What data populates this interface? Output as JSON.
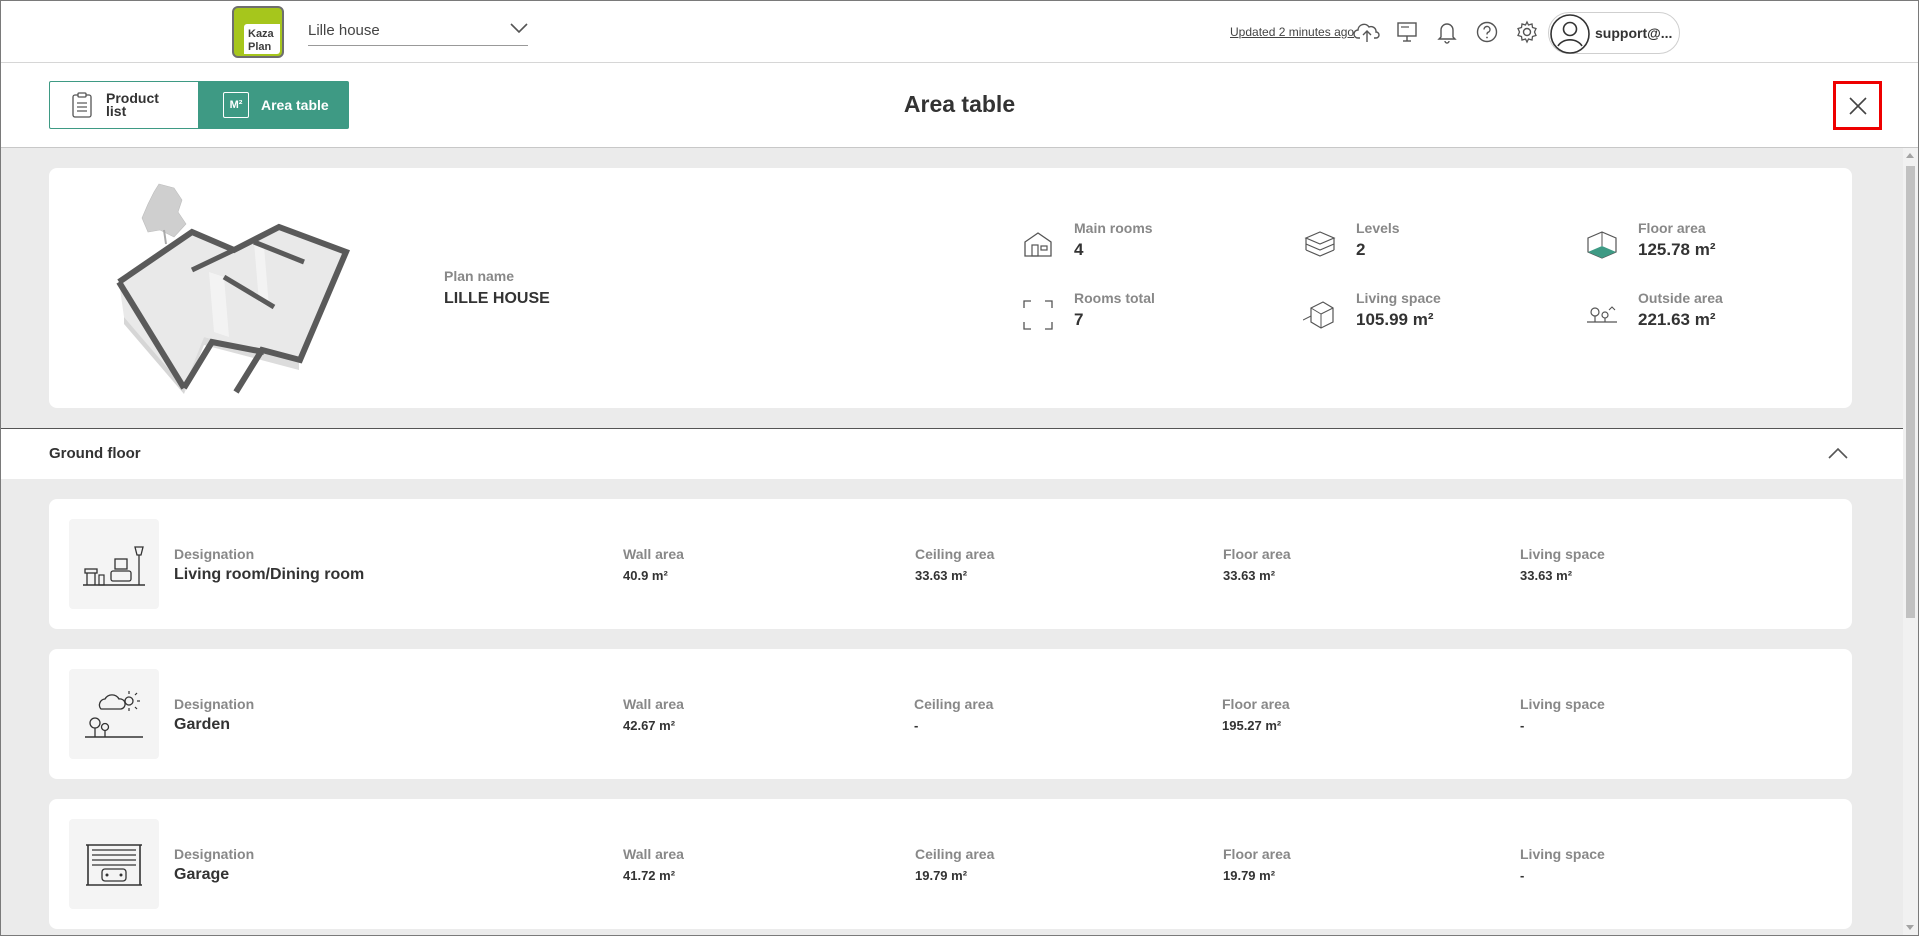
{
  "topbar": {
    "logo_line1": "Kaza",
    "logo_line2": "Plan",
    "plan_select_value": "Lille house",
    "updated_text": "Updated 2 minutes ago",
    "user_name": "support@..."
  },
  "header": {
    "tabs": [
      {
        "label": "Product list",
        "icon": "clipboard-icon",
        "active": false
      },
      {
        "label": "Area table",
        "icon_text": "M²",
        "active": true
      }
    ],
    "title": "Area table"
  },
  "summary": {
    "plan_name_label": "Plan name",
    "plan_name": "LILLE HOUSE",
    "stats": [
      {
        "label": "Main rooms",
        "value": "4",
        "icon": "house-icon"
      },
      {
        "label": "Levels",
        "value": "2",
        "icon": "levels-icon"
      },
      {
        "label": "Floor area",
        "value": "125.78 m²",
        "icon": "floor-area-icon"
      },
      {
        "label": "Rooms total",
        "value": "7",
        "icon": "rooms-total-icon"
      },
      {
        "label": "Living space",
        "value": "105.99 m²",
        "icon": "living-space-icon"
      },
      {
        "label": "Outside area",
        "value": "221.63 m²",
        "icon": "outside-area-icon"
      }
    ]
  },
  "section": {
    "title": "Ground floor"
  },
  "column_labels": {
    "designation": "Designation",
    "wall": "Wall area",
    "ceiling": "Ceiling area",
    "floor": "Floor area",
    "living": "Living space"
  },
  "rooms": [
    {
      "name": "Living room/Dining room",
      "wall": "40.9 m²",
      "ceiling": "33.63 m²",
      "floor": "33.63 m²",
      "living": "33.63 m²",
      "icon": "living-room-icon"
    },
    {
      "name": "Garden",
      "wall": "42.67 m²",
      "ceiling": "-",
      "floor": "195.27 m²",
      "living": "-",
      "icon": "garden-icon"
    },
    {
      "name": "Garage",
      "wall": "41.72 m²",
      "ceiling": "19.79 m²",
      "floor": "19.79 m²",
      "living": "-",
      "icon": "garage-icon"
    }
  ],
  "colors": {
    "accent": "#3e9a84",
    "logo_green": "#a6c61c",
    "close_highlight": "#ee0000"
  }
}
